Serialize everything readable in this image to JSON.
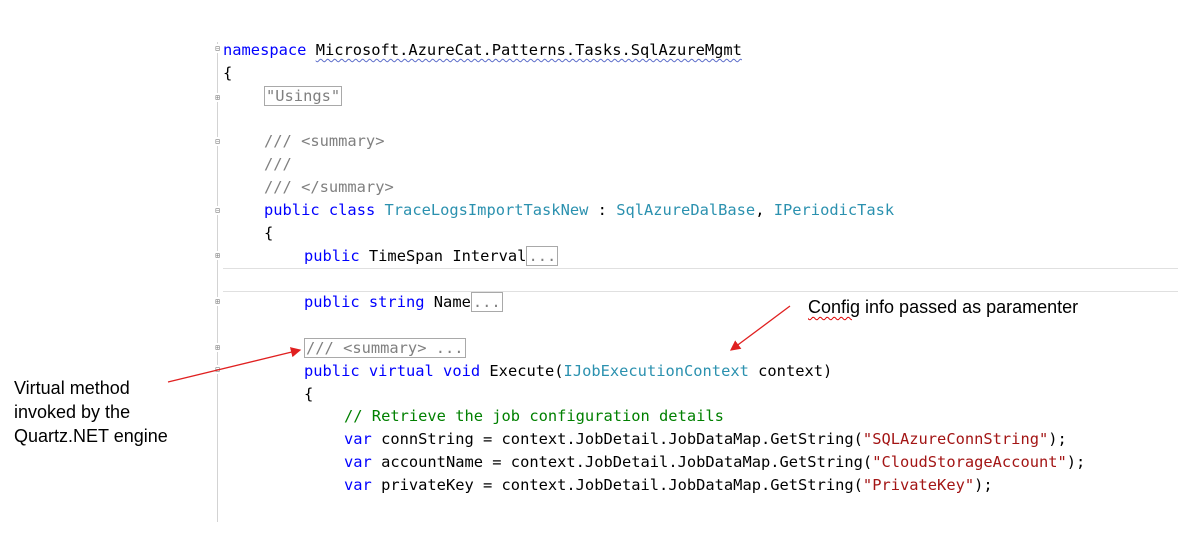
{
  "code": {
    "namespace_kw": "namespace",
    "namespace_name": "Microsoft.AzureCat.Patterns.Tasks.SqlAzureMgmt",
    "open_brace": "{",
    "usings_region": "\"Usings\"",
    "doc_summary_open": "/// <summary>",
    "doc_empty": "///",
    "doc_summary_close": "/// </summary>",
    "class_line": {
      "kw_public": "public",
      "kw_class": "class",
      "class_name": "TraceLogsImportTaskNew",
      "colon": " : ",
      "base1": "SqlAzureDalBase",
      "comma": ", ",
      "base2": "IPeriodicTask"
    },
    "class_open_brace": "{",
    "interval_line": {
      "kw_public": "public",
      "type": "TimeSpan",
      "name": "Interval",
      "collapsed": "..."
    },
    "name_line": {
      "kw_public": "public",
      "kw_string": "string",
      "name": "Name",
      "collapsed": "..."
    },
    "collapsed_summary": "/// <summary> ...",
    "execute_line": {
      "kw_public": "public",
      "kw_virtual": "virtual",
      "kw_void": "void",
      "method": "Execute(",
      "param_type": "IJobExecutionContext",
      "param": " context)"
    },
    "method_open_brace": "{",
    "comment": "// Retrieve the job configuration details",
    "conn_line": {
      "kw_var": "var",
      "body": " connString = context.JobDetail.JobDataMap.GetString(",
      "str": "\"SQLAzureConnString\"",
      "end": ");"
    },
    "account_line": {
      "kw_var": "var",
      "body": " accountName = context.JobDetail.JobDataMap.GetString(",
      "str": "\"CloudStorageAccount\"",
      "end": ");"
    },
    "key_line": {
      "kw_var": "var",
      "body": " privateKey = context.JobDetail.JobDataMap.GetString(",
      "str": "\"PrivateKey\"",
      "end": ");"
    }
  },
  "annotations": {
    "left": [
      "Virtual method",
      "invoked by the",
      "Quartz.NET engine"
    ],
    "right_word1": "Config",
    "right_rest": " info passed as paramenter"
  },
  "colors": {
    "keyword": "#0000ff",
    "type": "#2b91af",
    "string": "#a31515",
    "comment": "#008000",
    "doc": "#808080",
    "arrow": "#e02020"
  }
}
